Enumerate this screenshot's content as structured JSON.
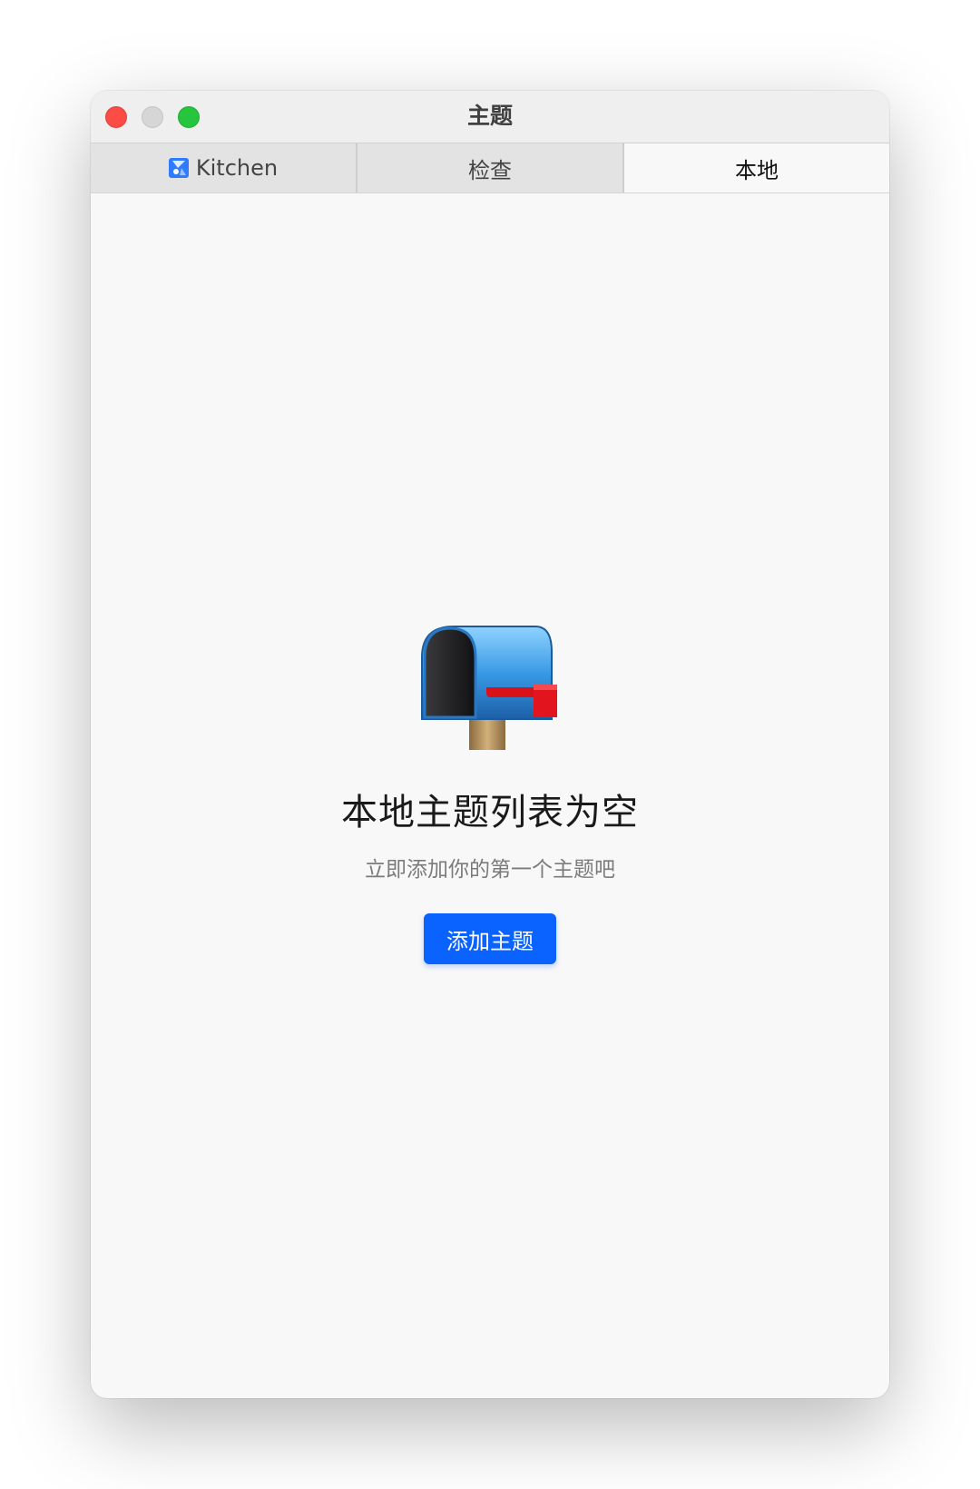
{
  "window": {
    "title": "主题"
  },
  "tabs": [
    {
      "label": "Kitchen",
      "icon": "kitchen-logo-icon",
      "active": false
    },
    {
      "label": "检查",
      "active": false
    },
    {
      "label": "本地",
      "active": true
    }
  ],
  "empty_state": {
    "icon": "mailbox-icon",
    "title": "本地主题列表为空",
    "subtitle": "立即添加你的第一个主题吧",
    "button_label": "添加主题"
  },
  "colors": {
    "accent": "#0a62ff",
    "close": "#fc4c46",
    "minimize": "#d6d6d6",
    "maximize": "#27c53e"
  }
}
